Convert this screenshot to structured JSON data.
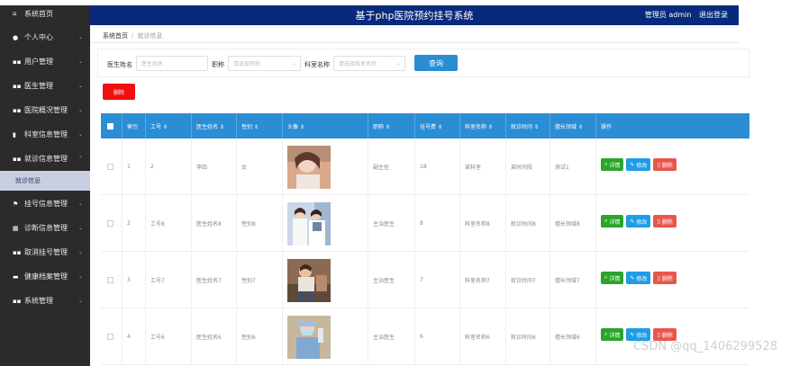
{
  "header": {
    "title": "基于php医院预约挂号系统",
    "admin": "管理员 admin",
    "logout": "退出登录"
  },
  "sidebar": {
    "items": [
      {
        "label": "系统首页",
        "icon": "home-icon"
      },
      {
        "label": "个人中心",
        "icon": "user-icon"
      },
      {
        "label": "用户管理",
        "icon": "grid-icon"
      },
      {
        "label": "医生管理",
        "icon": "grid-icon"
      },
      {
        "label": "医院概况管理",
        "icon": "grid-icon"
      },
      {
        "label": "科室信息管理",
        "icon": "file-icon"
      },
      {
        "label": "就诊信息管理",
        "icon": "grid-icon"
      },
      {
        "label": "挂号信息管理",
        "icon": "flag-icon"
      },
      {
        "label": "诊断信息管理",
        "icon": "table-icon"
      },
      {
        "label": "取消挂号管理",
        "icon": "grid-icon"
      },
      {
        "label": "健康档案管理",
        "icon": "book-icon"
      },
      {
        "label": "系统管理",
        "icon": "grid-icon"
      }
    ],
    "sub_item": "就诊信息"
  },
  "breadcrumb": {
    "home": "系统首页",
    "current": "就诊信息"
  },
  "search": {
    "doctor_label": "医生姓名",
    "doctor_placeholder": "医生姓名",
    "title_label": "职称",
    "title_placeholder": "请选择职称",
    "dept_label": "科室名称",
    "dept_placeholder": "请选择科室名称",
    "query_button": "查询"
  },
  "delete_button": "删除",
  "table": {
    "headers": [
      "索引",
      "工号 ⇕",
      "医生姓名 ⇕",
      "性别 ⇕",
      "头像 ⇕",
      "职称 ⇕",
      "挂号费 ⇕",
      "科室名称 ⇕",
      "就诊时间 ⇕",
      "擅长领域 ⇕",
      "操作"
    ],
    "rows": [
      {
        "index": "1",
        "id": "2",
        "name": "李四",
        "gender": "女",
        "title": "副主任",
        "fee": "18",
        "dept": "某科室",
        "time": "某时间段",
        "field": "测试1"
      },
      {
        "index": "2",
        "id": "工号8",
        "name": "医生姓名8",
        "gender": "性别8",
        "title": "主治医生",
        "fee": "8",
        "dept": "科室名称8",
        "time": "就诊时间8",
        "field": "擅长领域8"
      },
      {
        "index": "3",
        "id": "工号7",
        "name": "医生姓名7",
        "gender": "性别7",
        "title": "主治医生",
        "fee": "7",
        "dept": "科室名称7",
        "time": "就诊时间7",
        "field": "擅长领域7"
      },
      {
        "index": "4",
        "id": "工号6",
        "name": "医生姓名6",
        "gender": "性别6",
        "title": "主治医生",
        "fee": "6",
        "dept": "科室名称6",
        "time": "就诊时间6",
        "field": "擅长领域6"
      }
    ],
    "ops": {
      "detail": "详情",
      "edit": "修改",
      "delete": "删除"
    }
  },
  "watermark": "CSDN @qq_1406299528",
  "colors": {
    "header": "#082a7a",
    "sidebar": "#2b2b2b",
    "table_head": "#2b8dd4",
    "delete": "#f10f0f"
  }
}
